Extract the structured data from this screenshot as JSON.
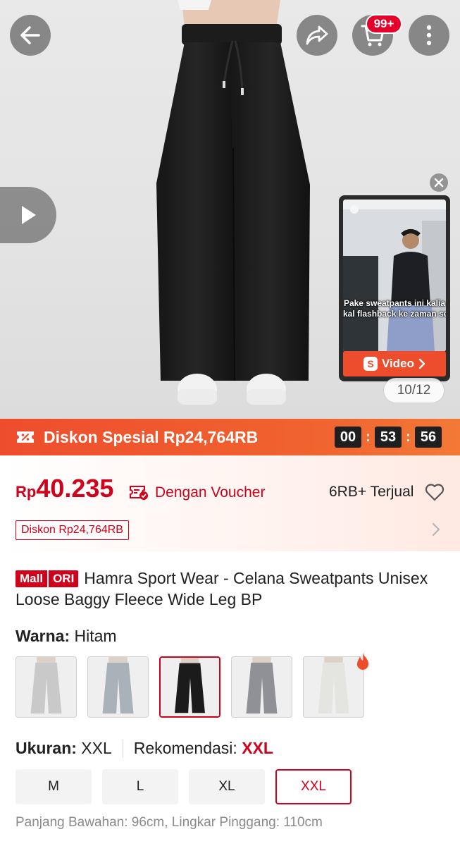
{
  "header": {
    "cart_badge": "99+"
  },
  "gallery": {
    "counter": "10/12",
    "video": {
      "caption_line1": "Pake sweatpants ini kalia",
      "caption_line2": "kal flashback ke zaman se",
      "button_label": "Video",
      "button_logo": "S"
    }
  },
  "flash_sale": {
    "label": "Diskon Spesial Rp24,764RB",
    "timer": {
      "hours": "00",
      "minutes": "53",
      "seconds": "56",
      "separator": ":"
    }
  },
  "price": {
    "currency": "Rp",
    "amount": "40.235",
    "voucher_text": "Dengan Voucher",
    "sold": "6RB+ Terjual",
    "discount_tag": "Diskon Rp24,764RB"
  },
  "product": {
    "badge_mall": "Mall",
    "badge_ori": "ORI",
    "title": "Hamra Sport Wear -  Celana Sweatpants Unisex Loose Baggy Fleece Wide Leg BP"
  },
  "variant": {
    "color_label": "Warna:",
    "color_value": "Hitam",
    "swatches": [
      {
        "color": "#c9c9c9",
        "selected": false
      },
      {
        "color": "#a9b1b9",
        "selected": false
      },
      {
        "color": "#1b1b1b",
        "selected": true
      },
      {
        "color": "#8f9196",
        "selected": false
      },
      {
        "color": "#e4e4e0",
        "selected": false
      }
    ],
    "size_label": "Ukuran:",
    "size_value": "XXL",
    "recommend_label": "Rekomendasi:",
    "recommend_value": "XXL",
    "sizes": [
      "M",
      "L",
      "XL",
      "XXL"
    ],
    "selected_size": "XXL",
    "measurement": "Panjang Bawahan: 96cm, Lingkar Pinggang: 110cm"
  },
  "colors": {
    "accent": "#ee4d2d",
    "price_red": "#d0011b"
  },
  "icons": [
    "back-arrow-icon",
    "share-icon",
    "cart-icon",
    "more-vertical-icon",
    "play-icon",
    "close-icon",
    "voucher-icon",
    "heart-icon",
    "chevron-right-icon",
    "fire-icon",
    "discount-tag-icon"
  ]
}
